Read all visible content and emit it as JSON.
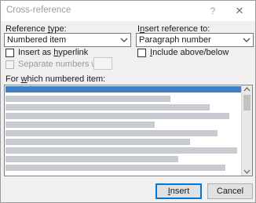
{
  "window": {
    "title": "Cross-reference",
    "help_glyph": "?",
    "close_glyph": "✕"
  },
  "reference_type": {
    "label_pre": "Reference ",
    "label_u": "t",
    "label_post": "ype:",
    "value": "Numbered item"
  },
  "insert_reference_to": {
    "label_pre": "I",
    "label_u": "n",
    "label_post": "sert reference to:",
    "value": "Paragraph number"
  },
  "options": {
    "hyperlink_pre": "Insert as ",
    "hyperlink_u": "h",
    "hyperlink_post": "yperlink",
    "hyperlink_checked": false,
    "include_pre": "",
    "include_u": "I",
    "include_post": "nclude above/below",
    "include_checked": false,
    "separate_label": "Separate numbers with",
    "separate_checked": false,
    "separate_value": ""
  },
  "list": {
    "label_pre": "For ",
    "label_u": "w",
    "label_post": "hich numbered item:",
    "selected_index": 0
  },
  "buttons": {
    "insert_pre": "",
    "insert_u": "I",
    "insert_post": "nsert",
    "cancel": "Cancel"
  },
  "colors": {
    "selection": "#3d7fc9",
    "default_button_border": "#0078d7",
    "dialog_background": "#f0f0f0"
  },
  "icons": {
    "dropdown": "chevron-down-icon",
    "scroll_up": "scroll-up-arrow-icon",
    "scroll_down": "scroll-down-arrow-icon"
  }
}
